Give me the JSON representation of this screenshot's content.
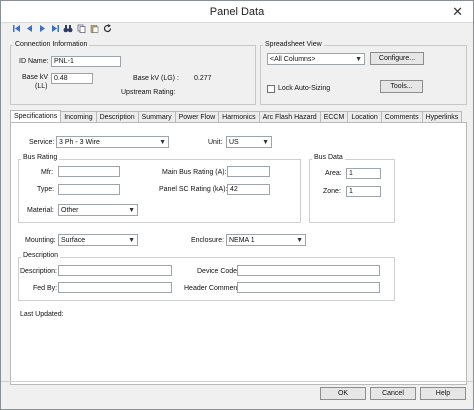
{
  "window": {
    "title": "Panel Data",
    "close_glyph": "✕"
  },
  "toolbar": {
    "icons": [
      "first-icon",
      "prev-icon",
      "next-icon",
      "last-icon",
      "binoculars-icon",
      "copy-icon",
      "paste-icon",
      "refresh-icon"
    ]
  },
  "connection": {
    "group_label": "Connection Information",
    "id_label": "ID Name:",
    "id_value": "PNL-1",
    "basekv_label": "Base kV",
    "basekv_ll": "(LL)",
    "basekv_value": "0.48",
    "basekv_lg_label": "Base kV (LG) :",
    "basekv_lg_value": "0.277",
    "upstream_label": "Upstream Rating:"
  },
  "spreadsheet": {
    "group_label": "Spreadsheet View",
    "columns_value": "<All Columns>",
    "configure_btn": "Configure...",
    "lock_label": "Lock Auto-Sizing",
    "tools_btn": "Tools..."
  },
  "tabs": [
    "Specifications",
    "Incoming",
    "Description",
    "Spreadsheet Setup",
    "Summary",
    "Power Flow",
    "Harmonics",
    "Arc Flash Hazard",
    "ECCM",
    "Location",
    "Comments",
    "Hyperlinks"
  ],
  "tab_display": [
    "Specifications",
    "Incoming",
    "Description",
    "Setup",
    "Summary",
    "Power Flow",
    "Harmonics",
    "Arc Flash Hazard",
    "ECCM",
    "Location",
    "Comments",
    "Hyperlinks"
  ],
  "spec": {
    "service_label": "Service:",
    "service_value": "3 Ph - 3 Wire",
    "unit_label": "Unit:",
    "unit_value": "US",
    "bus_rating_label": "Bus Rating",
    "mfr_label": "Mfr:",
    "mfr_value": "",
    "type_label": "Type:",
    "type_value": "",
    "material_label": "Material:",
    "material_value": "Other",
    "main_bus_label": "Main Bus Rating (A):",
    "main_bus_value": "",
    "panel_sc_label": "Panel SC Rating (kA):",
    "panel_sc_value": "42",
    "bus_data_label": "Bus Data",
    "area_label": "Area:",
    "area_value": "1",
    "zone_label": "Zone:",
    "zone_value": "1",
    "mounting_label": "Mounting:",
    "mounting_value": "Surface",
    "enclosure_label": "Enclosure:",
    "enclosure_value": "NEMA 1",
    "description_group": "Description",
    "description_label": "Description:",
    "description_value": "",
    "device_code_label": "Device Code:",
    "device_code_value": "",
    "fed_by_label": "Fed By:",
    "fed_by_value": "",
    "header_comment_label": "Header Comment:",
    "header_comment_value": "",
    "last_updated_label": "Last Updated:"
  },
  "buttons": {
    "ok": "OK",
    "cancel": "Cancel",
    "help": "Help"
  }
}
